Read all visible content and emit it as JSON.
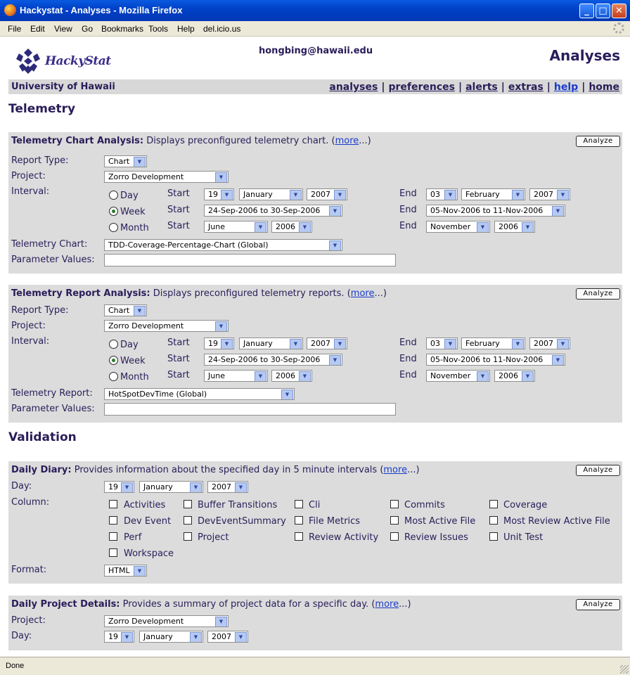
{
  "window": {
    "title": "Hackystat - Analyses - Mozilla Firefox"
  },
  "menu": [
    "File",
    "Edit",
    "View",
    "Go",
    "Bookmarks",
    "Tools",
    "Help",
    "del.icio.us"
  ],
  "status": "Done",
  "header": {
    "logo_text": "HackyStat",
    "user": "hongbing@hawaii.edu",
    "page_title": "Analyses",
    "university": "University of Hawaii",
    "nav": [
      "analyses",
      "preferences",
      "alerts",
      "extras",
      "help",
      "home"
    ]
  },
  "sections": {
    "telemetry": "Telemetry",
    "validation": "Validation"
  },
  "common": {
    "analyze": "Analyze",
    "more": "more",
    "ellipsis_close": "...)",
    "open_paren": "(",
    "report_type_label": "Report Type:",
    "project_label": "Project:",
    "interval_label": "Interval:",
    "param_label": "Parameter Values:",
    "day": "Day",
    "week": "Week",
    "month": "Month",
    "start": "Start",
    "end": "End",
    "report_type_value": "Chart",
    "project_value": "Zorro Development",
    "start_day": "19",
    "start_month": "January",
    "start_year": "2007",
    "end_day": "03",
    "end_month": "February",
    "end_year": "2007",
    "start_week": "24-Sep-2006 to 30-Sep-2006",
    "end_week": "05-Nov-2006 to 11-Nov-2006",
    "start_mon": "June",
    "start_mon_year": "2006",
    "end_mon": "November",
    "end_mon_year": "2006"
  },
  "chart_panel": {
    "title": "Telemetry Chart Analysis:",
    "desc": " Displays preconfigured telemetry chart. ",
    "chart_label": "Telemetry Chart:",
    "chart_value": "TDD-Coverage-Percentage-Chart (Global)"
  },
  "report_panel": {
    "title": "Telemetry Report Analysis:",
    "desc": " Displays preconfigured telemetry reports. ",
    "report_label": "Telemetry Report:",
    "report_value": "HotSpotDevTime (Global)"
  },
  "diary_panel": {
    "title": "Daily Diary:",
    "desc": " Provides information about the specified day in 5 minute intervals ",
    "day_label": "Day:",
    "column_label": "Column:",
    "format_label": "Format:",
    "format_value": "HTML",
    "columns": [
      "Activities",
      "Buffer Transitions",
      "Cli",
      "Commits",
      "Coverage",
      "Dev Event",
      "DevEventSummary",
      "File Metrics",
      "Most Active File",
      "Most Review Active File",
      "Perf",
      "Project",
      "Review Activity",
      "Review Issues",
      "Unit Test",
      "Workspace"
    ]
  },
  "project_panel": {
    "title": "Daily Project Details:",
    "desc": " Provides a summary of project data for a specific day. ",
    "project_label": "Project:",
    "day_label": "Day:"
  }
}
